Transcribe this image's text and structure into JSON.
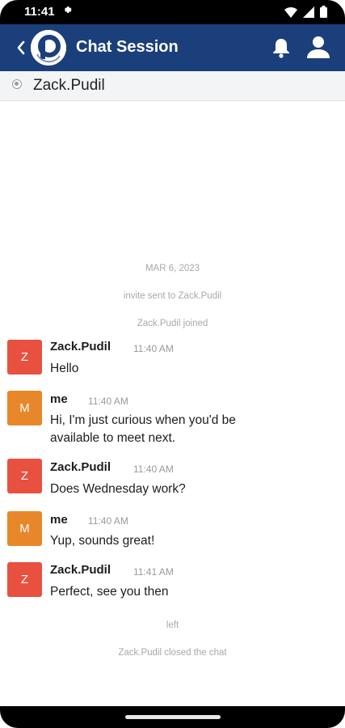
{
  "status_bar": {
    "time": "11:41",
    "icons": [
      "gear-icon",
      "wifi-icon",
      "cellular-icon",
      "battery-icon"
    ]
  },
  "header": {
    "title": "Chat Session",
    "color": "#1b3f7a",
    "icons": [
      "back-icon",
      "app-logo",
      "bell-icon",
      "user-icon"
    ]
  },
  "session": {
    "contact": "Zack.Pudil",
    "status_icon": "radio-icon"
  },
  "events": {
    "date": "MAR 6, 2023",
    "invite": "invite sent to Zack.Pudil",
    "joined": "Zack.Pudil joined",
    "left": "left",
    "closed": "Zack.Pudil closed the chat"
  },
  "messages": [
    {
      "initial": "Z",
      "sender": "Zack.Pudil",
      "time": "11:40 AM",
      "text": "Hello",
      "color": "#e8503f"
    },
    {
      "initial": "M",
      "sender": "me",
      "time": "11:40 AM",
      "text": "Hi, I'm just curious when you'd be available to meet next.",
      "color": "#e8872a"
    },
    {
      "initial": "Z",
      "sender": "Zack.Pudil",
      "time": "11:40 AM",
      "text": "Does Wednesday work?",
      "color": "#e8503f"
    },
    {
      "initial": "M",
      "sender": "me",
      "time": "11:40 AM",
      "text": "Yup, sounds great!",
      "color": "#e8872a"
    },
    {
      "initial": "Z",
      "sender": "Zack.Pudil",
      "time": "11:41 AM",
      "text": "Perfect, see you then",
      "color": "#e8503f"
    }
  ]
}
